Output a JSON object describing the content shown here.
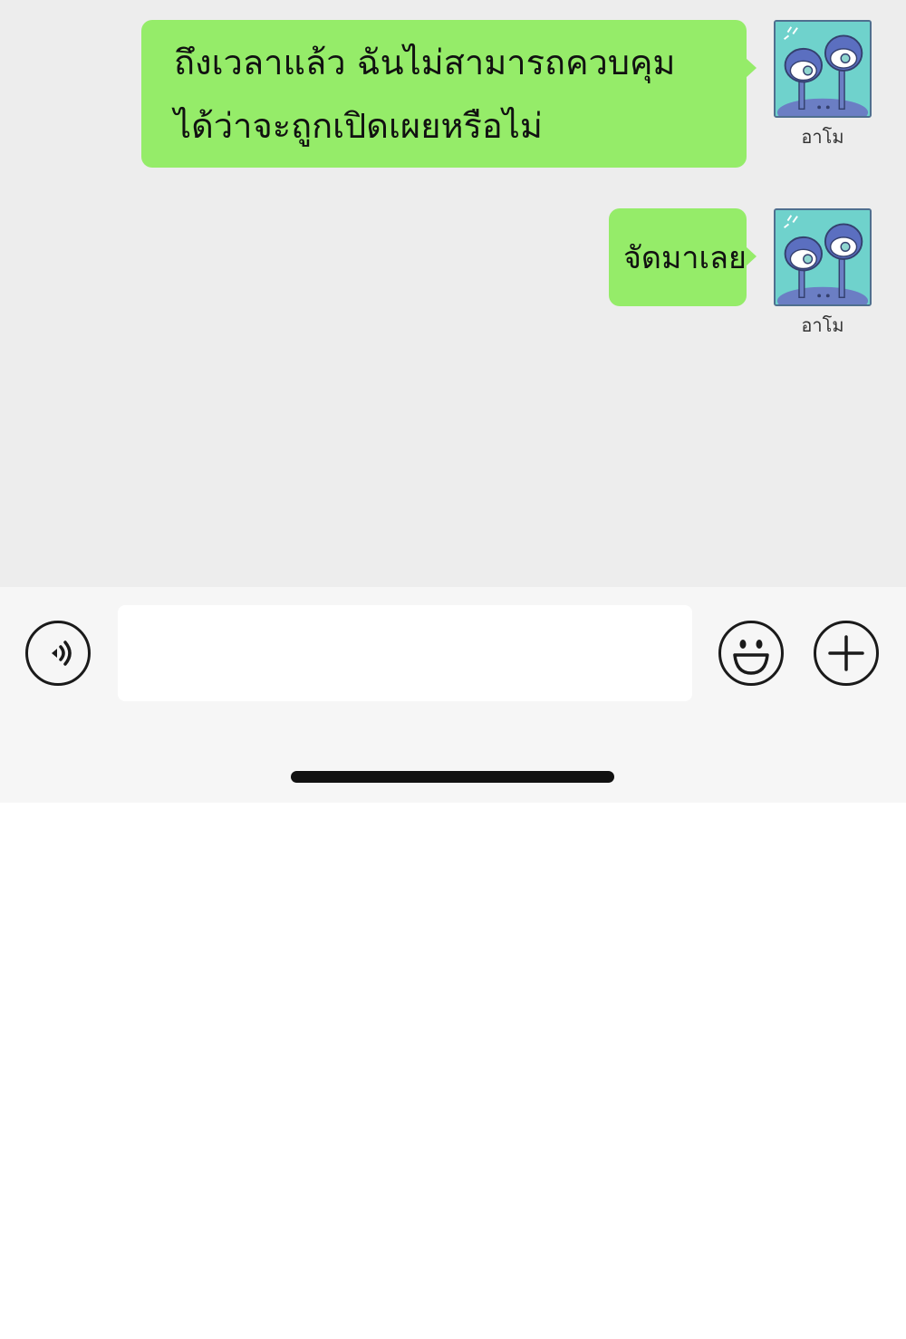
{
  "messages": [
    {
      "lines": [
        "ถึงเวลาแล้ว ฉันไม่สามารถควบคุม",
        "ได้ว่าจะถูกเปิดเผยหรือไม่"
      ],
      "sender_name": "อาโม",
      "avatar_icon": "cartoon-eyestalk-creatures-avatar"
    },
    {
      "lines": [
        "จัดมาเลย"
      ],
      "sender_name": "อาโม",
      "avatar_icon": "cartoon-eyestalk-creatures-avatar"
    }
  ],
  "input_bar": {
    "text_value": "",
    "voice_icon": "voice-icon",
    "emoji_icon": "smiley-icon",
    "plus_icon": "plus-icon"
  },
  "colors": {
    "bubble": "#95ec69",
    "chat_background": "#ededed",
    "input_bar_background": "#f6f6f6"
  }
}
